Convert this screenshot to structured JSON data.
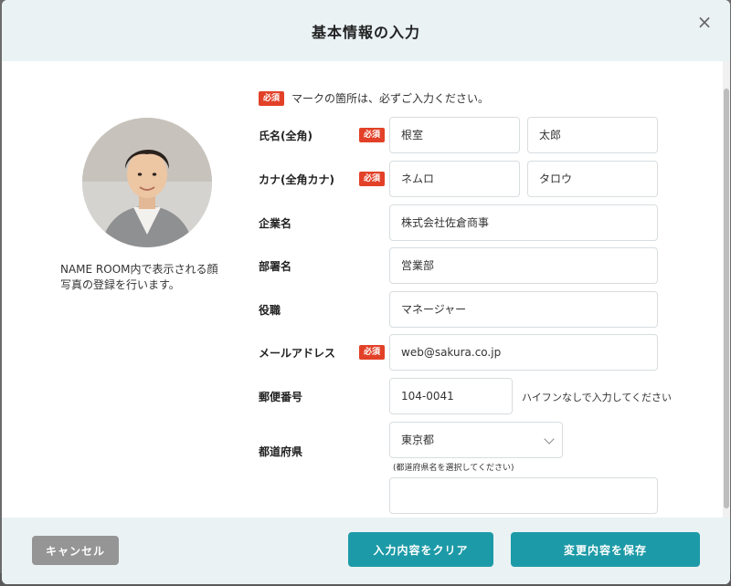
{
  "modal": {
    "title": "基本情報の入力",
    "close_label": "×"
  },
  "photo": {
    "caption": "NAME ROOM内で表示される顔写真の登録を行います。"
  },
  "notice": {
    "badge": "必須",
    "text": "マークの箇所は、必ずご入力ください。"
  },
  "form": {
    "name": {
      "label": "氏名(全角)",
      "badge": "必須",
      "last": "根室",
      "first": "太郎"
    },
    "kana": {
      "label": "カナ(全角カナ)",
      "badge": "必須",
      "last": "ネムロ",
      "first": "タロウ"
    },
    "company": {
      "label": "企業名",
      "value": "株式会社佐倉商事"
    },
    "department": {
      "label": "部署名",
      "value": "営業部"
    },
    "position": {
      "label": "役職",
      "value": "マネージャー"
    },
    "email": {
      "label": "メールアドレス",
      "badge": "必須",
      "value": "web@sakura.co.jp"
    },
    "postal": {
      "label": "郵便番号",
      "value": "104-0041",
      "hint": "ハイフンなしで入力してください"
    },
    "prefecture": {
      "label": "都道府県",
      "value": "東京都",
      "hint": "(都道府県名を選択してください)"
    },
    "next_field": {
      "value": ""
    }
  },
  "footer": {
    "cancel_label": "キャンセル",
    "clear_label": "入力内容をクリア",
    "save_label": "変更内容を保存"
  },
  "colors": {
    "accent": "#1d9aa7",
    "required": "#e24128",
    "header_bg": "#eaf2f4",
    "cancel_bg": "#959595"
  }
}
